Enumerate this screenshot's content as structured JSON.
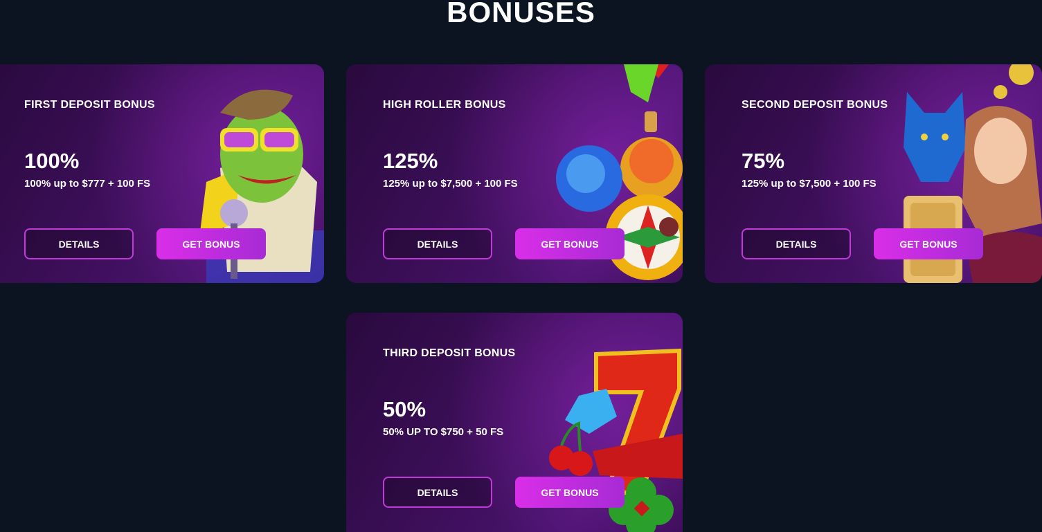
{
  "page": {
    "title": "BONUSES"
  },
  "cards": [
    {
      "title": "FIRST DEPOSIT BONUS",
      "percent": "100%",
      "description": "100% up to $777 + 100 FS",
      "details_label": "DETAILS",
      "get_label": "GET BONUS",
      "art_icon": "frog-singer-icon"
    },
    {
      "title": "HIGH ROLLER BONUS",
      "percent": "125%",
      "description": "125% up to $7,500 + 100 FS",
      "details_label": "DETAILS",
      "get_label": "GET BONUS",
      "art_icon": "gems-candy-icon"
    },
    {
      "title": "SECOND DEPOSIT BONUS",
      "percent": "75%",
      "description": "125% up to $7,500 + 100 FS",
      "details_label": "DETAILS",
      "get_label": "GET BONUS",
      "art_icon": "wolf-princess-icon"
    },
    {
      "title": "THIRD DEPOSIT BONUS",
      "percent": "50%",
      "description": "50% UP TO $750 + 50 FS",
      "details_label": "DETAILS",
      "get_label": "GET BONUS",
      "art_icon": "lucky-seven-icon"
    }
  ],
  "colors": {
    "background": "#0b1420",
    "card_purple": "#3d0f5a",
    "accent_magenta": "#d92ee8",
    "details_border": "#c238d9"
  }
}
